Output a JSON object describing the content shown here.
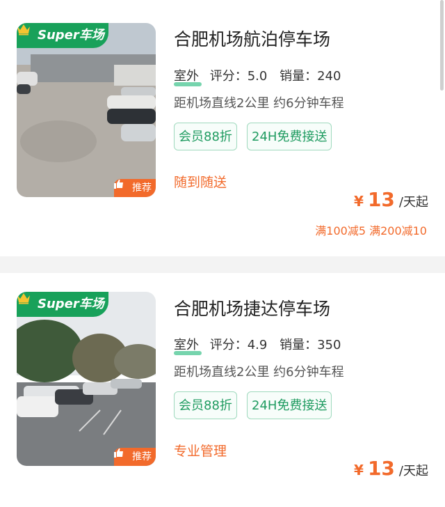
{
  "listings": [
    {
      "badge_super": "Super车场",
      "badge_rec": "推荐",
      "name": "合肥机场航泊停车场",
      "type": "室外",
      "rating": "评分：5.0",
      "sales": "销量：240",
      "distance": "距机场直线2公里 约6分钟车程",
      "chips": [
        "会员88折",
        "24H免费接送"
      ],
      "service": "随到随送",
      "currency": "¥",
      "price": "13",
      "price_unit": "/天起",
      "promo": "满100减5 满200减10"
    },
    {
      "badge_super": "Super车场",
      "badge_rec": "推荐",
      "name": "合肥机场捷达停车场",
      "type": "室外",
      "rating": "评分：4.9",
      "sales": "销量：350",
      "distance": "距机场直线2公里 约6分钟车程",
      "chips": [
        "会员88折",
        "24H免费接送"
      ],
      "service": "专业管理",
      "currency": "¥",
      "price": "13",
      "price_unit": "/天起"
    }
  ],
  "colors": {
    "brand_green": "#18a15a",
    "accent_orange": "#f26a2b",
    "chip_green": "#1f9b60"
  },
  "icons": {
    "super_badge": "crown-icon",
    "recommend_badge": "thumbs-up-icon"
  }
}
